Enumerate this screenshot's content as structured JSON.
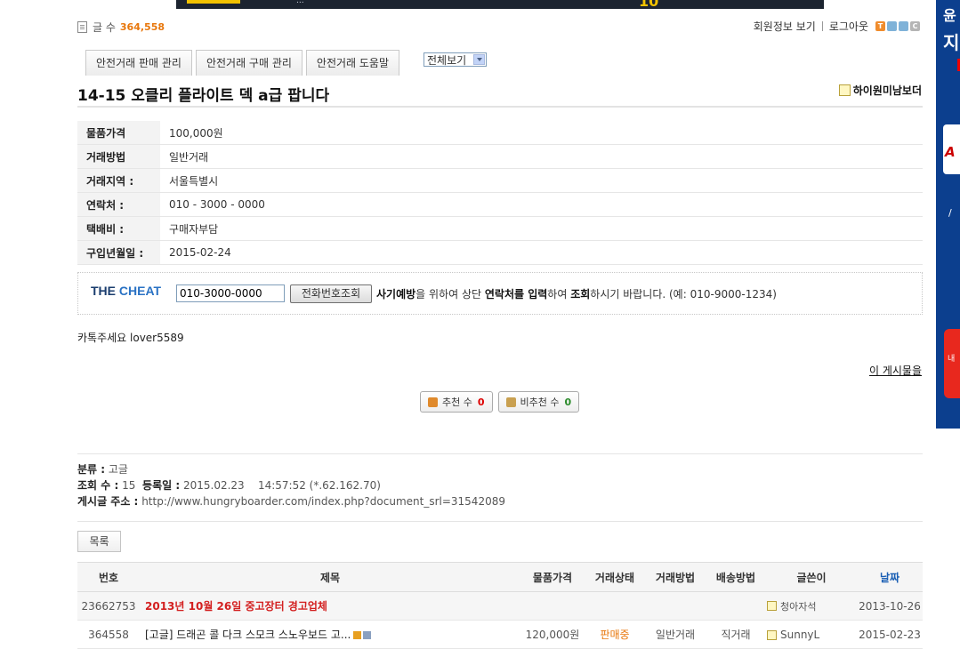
{
  "top_banner": {
    "text": "...",
    "number": "10"
  },
  "right_ad": {
    "line1": "윤",
    "line2": "지",
    "line3": "A",
    "line4": "/ ",
    "line5": "내"
  },
  "header": {
    "post_count_label": "글 수",
    "post_count": "364,558",
    "member_info": "회원정보 보기",
    "logout": "로그아웃",
    "skin_buttons": [
      "T",
      "",
      "",
      "C"
    ]
  },
  "tabs": [
    "안전거래 판매 관리",
    "안전거래 구매 관리",
    "안전거래 도움말"
  ],
  "view_select": "전체보기",
  "post": {
    "title": "14-15 오클리 플라이트 덱 a급 팝니다",
    "author": "하이원미남보더",
    "fields": [
      {
        "label": "물품가격",
        "value": "100,000원"
      },
      {
        "label": "거래방법",
        "value": "일반거래"
      },
      {
        "label": "거래지역 :",
        "value": "서울특별시"
      },
      {
        "label": "연락처 :",
        "value": "010 - 3000 - 0000"
      },
      {
        "label": "택배비 :",
        "value": "구매자부담"
      },
      {
        "label": "구입년월일 :",
        "value": "2015-02-24"
      }
    ],
    "body": "카톡주세요 lover5589",
    "permalink": "이 게시물을"
  },
  "cheat": {
    "logo_a": "THE ",
    "logo_b": "CHEAT",
    "phone_value": "010-3000-0000",
    "button": "전화번호조회",
    "msg_b1": "사기예방",
    "msg_1": "을 위하여 상단 ",
    "msg_b2": "연락처를 입력",
    "msg_2": "하여 ",
    "msg_b3": "조회",
    "msg_3": "하시기 바랍니다. (예: 010-9000-1234)"
  },
  "votes": {
    "up_label": "추천 수",
    "up_count": "0",
    "down_label": "비추천 수",
    "down_count": "0"
  },
  "meta": {
    "category_label": "분류 :",
    "category": "고글",
    "views_label": "조회 수 :",
    "views": "15",
    "reg_label": "등록일 :",
    "reg_date": "2015.02.23",
    "reg_time": "14:57:52 (*.62.162.70)",
    "url_label": "게시글 주소 :",
    "url": "http://www.hungryboarder.com/index.php?document_srl=31542089"
  },
  "list_button": "목록",
  "board": {
    "headers": [
      "번호",
      "제목",
      "물품가격",
      "거래상태",
      "거래방법",
      "배송방법",
      "글쓴이",
      "날짜"
    ],
    "rows": [
      {
        "no": "23662753",
        "title": "2013년 10월 26일 중고장터 경고업체",
        "price": "",
        "status": "",
        "method": "",
        "ship": "",
        "writer": "청아자석",
        "date": "2013-10-26"
      },
      {
        "no": "364558",
        "title": "[고글] 드래곤 콜 다크 스모크 스노우보드 고...",
        "price": "120,000원",
        "status": "판매중",
        "method": "일반거래",
        "ship": "직거래",
        "writer": "SunnyL",
        "date": "2015-02-23"
      }
    ]
  }
}
